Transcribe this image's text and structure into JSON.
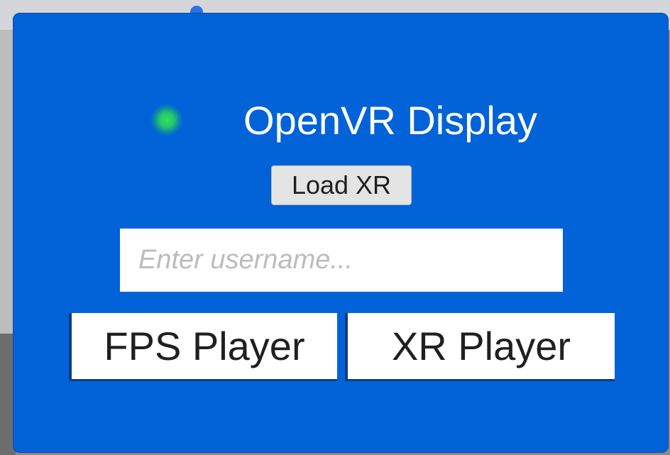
{
  "panel": {
    "title": "OpenVR Display",
    "status_color": "#22c86a",
    "background_color": "#0263d8"
  },
  "load_button": {
    "label": "Load XR"
  },
  "username_field": {
    "value": "",
    "placeholder": "Enter username..."
  },
  "player_buttons": {
    "fps_label": "FPS Player",
    "xr_label": "XR Player"
  }
}
